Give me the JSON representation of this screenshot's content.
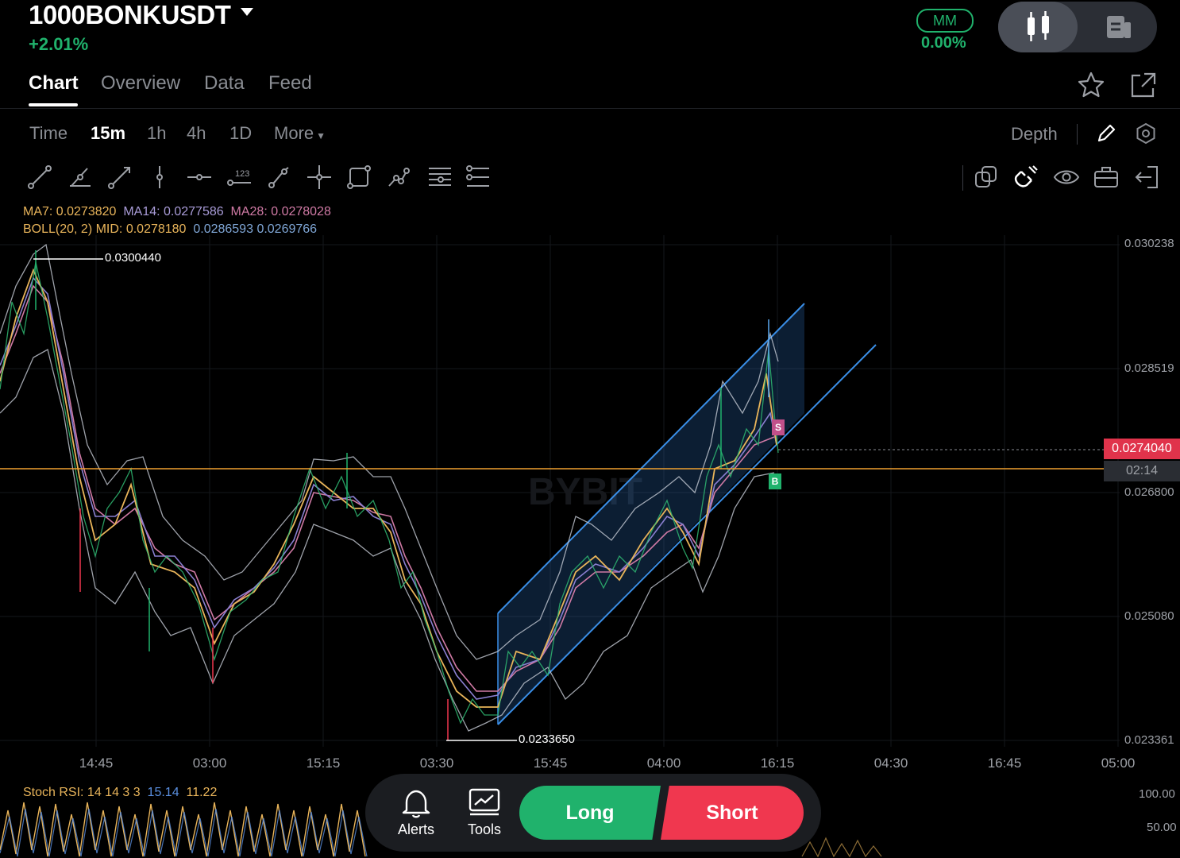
{
  "header": {
    "symbol": "1000BONKUSDT",
    "change": "+2.01%",
    "mm_label": "MM",
    "mm_value": "0.00%",
    "view_icons": [
      "candlestick-icon",
      "orderbook-icon"
    ]
  },
  "tabs": [
    {
      "label": "Chart",
      "active": true
    },
    {
      "label": "Overview"
    },
    {
      "label": "Data"
    },
    {
      "label": "Feed"
    }
  ],
  "intervals": [
    "Time",
    "15m",
    "1h",
    "4h",
    "1D",
    "More"
  ],
  "active_interval": "15m",
  "depth_label": "Depth",
  "drawing_tools": [
    "trend-line-icon",
    "angle-icon",
    "ray-icon",
    "vertical-line-icon",
    "horizontal-line-icon",
    "price-range-icon",
    "fib-icon",
    "crosshair-icon",
    "rectangle-icon",
    "path-icon",
    "parallel-channel-icon",
    "fib-levels-icon"
  ],
  "right_tools": [
    "layers-icon",
    "magnet-icon",
    "eye-icon",
    "toolbox-icon",
    "exit-icon"
  ],
  "indicators": {
    "ma7": "MA7: 0.0273820",
    "ma14": "MA14: 0.0277586",
    "ma28": "MA28: 0.0278028",
    "boll_mid": "BOLL(20, 2) MID: 0.0278180",
    "boll_up": "0.0286593",
    "boll_low": "0.0269766"
  },
  "chart": {
    "y_ticks": [
      "0.030238",
      "0.028519",
      "0.026800",
      "0.025080",
      "0.023361"
    ],
    "x_ticks": [
      "14:45",
      "03:00",
      "15:15",
      "03:30",
      "15:45",
      "04:00",
      "16:15",
      "04:30",
      "16:45",
      "05:00"
    ],
    "current_price": "0.0274040",
    "countdown": "02:14",
    "high_label": "0.0300440",
    "low_label": "0.0233650",
    "sell_marker": "S",
    "buy_marker": "B",
    "watermark": "BYBIT",
    "colors": {
      "up": "#20b26c",
      "down": "#f0374f",
      "horizontal_line": "#f0a030",
      "channel": "#3a8ee6"
    }
  },
  "stoch": {
    "label": "Stoch RSI: 14 14 3 3",
    "k": "15.14",
    "d": "11.22",
    "level_100": "100.00",
    "level_50": "50.00"
  },
  "bottom_bar": {
    "alerts": "Alerts",
    "tools": "Tools",
    "long": "Long",
    "short": "Short"
  }
}
